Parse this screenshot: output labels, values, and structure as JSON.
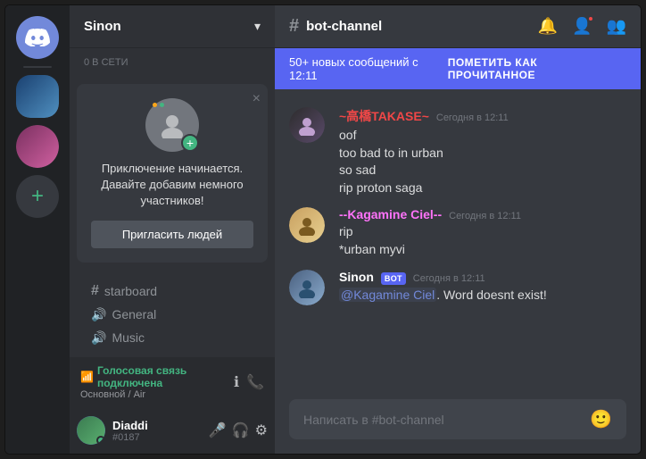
{
  "app": {
    "title": "Discord"
  },
  "server_sidebar": {
    "discord_label": "DISCORD",
    "add_server_label": "+"
  },
  "channel_sidebar": {
    "server_name": "Sinon",
    "online_count": "0 В СЕТИ",
    "invite_card": {
      "title": "Приключение начинается. Давайте добавим немного участников!",
      "button_label": "Пригласить людей",
      "close_label": "×"
    },
    "categories": [],
    "channels": [
      {
        "type": "text",
        "name": "starboard"
      },
      {
        "type": "voice",
        "name": "General"
      },
      {
        "type": "voice",
        "name": "Music"
      }
    ],
    "voice_status": {
      "connected_text": "Голосовая связь подключена",
      "channel": "Основной / Air"
    },
    "user": {
      "name": "Diaddi",
      "discriminator": "#0187"
    }
  },
  "chat": {
    "channel_name": "bot-channel",
    "unread_banner": {
      "text": "50+ новых сообщений с 12:11",
      "action": "ПОМЕТИТЬ КАК ПРОЧИТАННОЕ"
    },
    "messages": [
      {
        "id": "msg1",
        "username": "~高橋TAKASE~",
        "timestamp": "Сегодня в 12:11",
        "lines": [
          "oof",
          "too bad to in urban",
          "so sad",
          "rip proton saga"
        ],
        "avatar_type": "takase"
      },
      {
        "id": "msg2",
        "username": "--Kagamine Ciel--",
        "timestamp": "Сегодня в 12:11",
        "lines": [
          "rip",
          "*urban myvi"
        ],
        "avatar_type": "kagamine"
      },
      {
        "id": "msg3",
        "username": "Sinon",
        "timestamp": "Сегодня в 12:11",
        "is_bot": true,
        "lines": [
          "@Kagamine Ciel. Word doesnt exist!"
        ],
        "avatar_type": "sinon"
      }
    ],
    "input_placeholder": "Написать в #bot-channel"
  }
}
